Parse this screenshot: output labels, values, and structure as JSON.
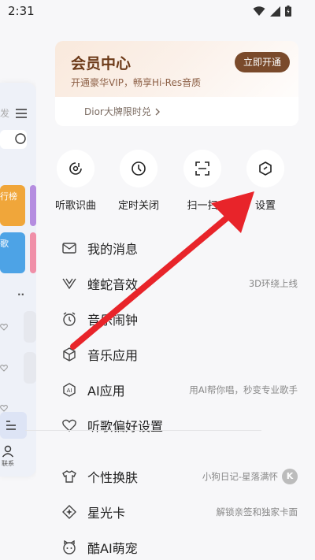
{
  "status_bar": {
    "time": "2:31"
  },
  "background_page": {
    "fragments": [
      "发",
      "行榜",
      "歌",
      "联系"
    ]
  },
  "vip": {
    "title": "会员中心",
    "subtitle": "开通豪华VIP，畅享Hi-Res音质",
    "button": "立即开通",
    "promo": "Dior大牌限时兑"
  },
  "quick_actions": [
    {
      "label": "听歌识曲",
      "icon": "recognize-song-icon"
    },
    {
      "label": "定时关闭",
      "icon": "timer-icon"
    },
    {
      "label": "扫一扫",
      "icon": "scan-icon"
    },
    {
      "label": "设置",
      "icon": "settings-icon"
    }
  ],
  "menu": [
    {
      "label": "我的消息",
      "right": "",
      "icon": "message-icon"
    },
    {
      "label": "蝰蛇音效",
      "right": "3D环绕上线",
      "icon": "viper-sound-icon"
    },
    {
      "label": "音乐闹钟",
      "right": "",
      "icon": "alarm-icon"
    },
    {
      "label": "音乐应用",
      "right": "",
      "icon": "music-apps-icon"
    },
    {
      "label": "AI应用",
      "right": "用AI帮你唱，秒变专业歌手",
      "icon": "ai-icon"
    },
    {
      "label": "听歌偏好设置",
      "right": "",
      "icon": "preference-icon"
    },
    {
      "label": "个性换肤",
      "right": "小狗日记-星落满怀",
      "icon": "skin-icon"
    },
    {
      "label": "星光卡",
      "right": "解锁亲签和独家卡面",
      "icon": "star-card-icon"
    },
    {
      "label": "酷AI萌宠",
      "right": "",
      "icon": "ai-pet-icon"
    }
  ],
  "colors": {
    "vip_title": "#6d3b1a",
    "vip_button": "#7a4a2b",
    "arrow": "#e8242a",
    "background": "#f7f7f9"
  }
}
